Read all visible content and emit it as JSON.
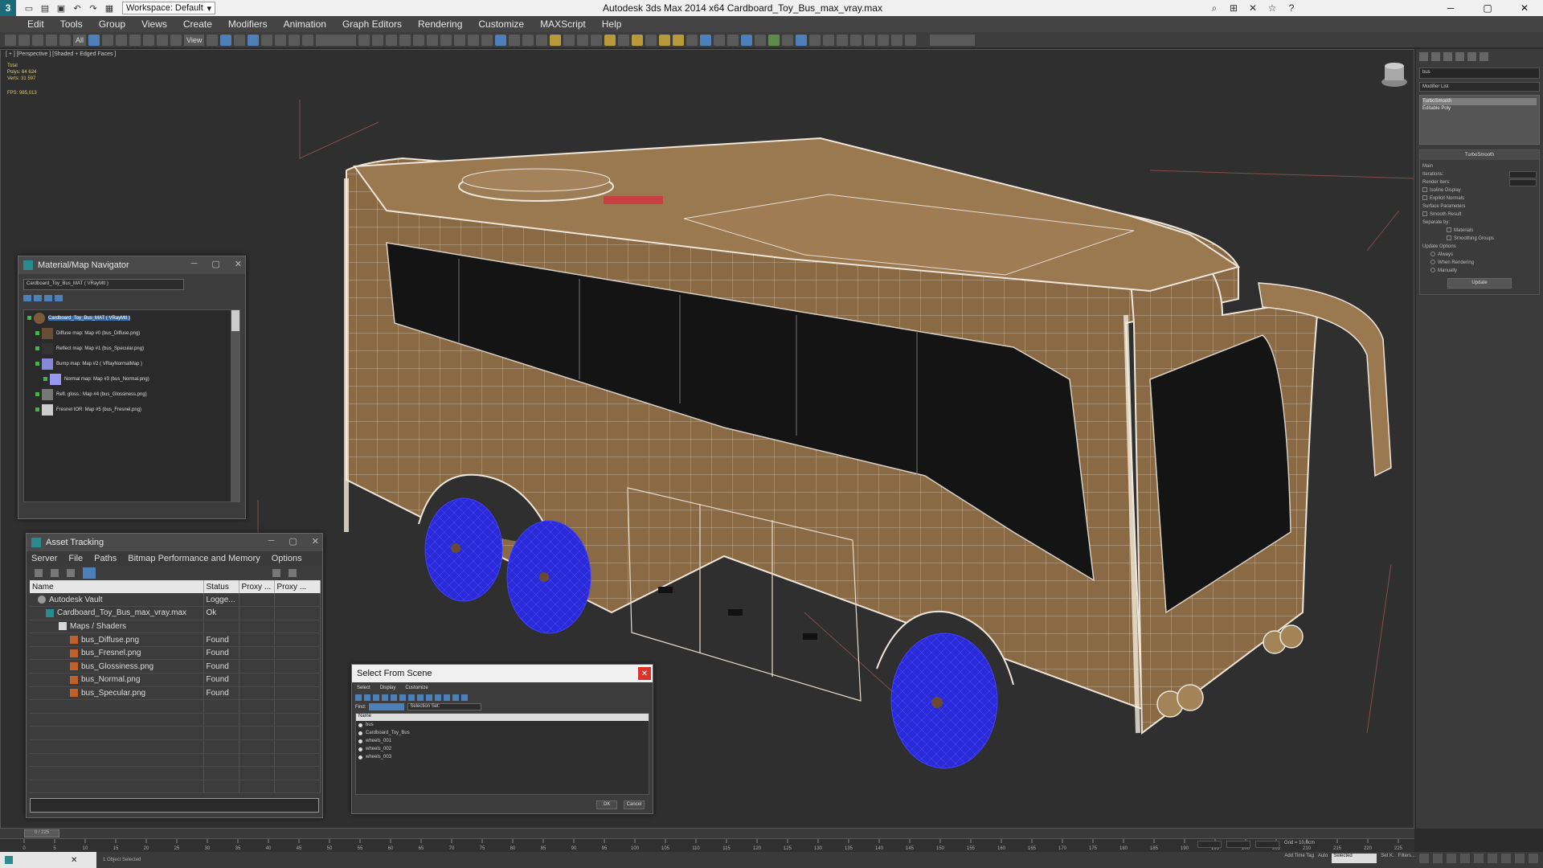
{
  "titlebar": {
    "workspace": "Workspace: Default",
    "title": "Autodesk 3ds Max  2014 x64      Cardboard_Toy_Bus_max_vray.max"
  },
  "menu": [
    "Edit",
    "Tools",
    "Group",
    "Views",
    "Create",
    "Modifiers",
    "Animation",
    "Graph Editors",
    "Rendering",
    "Customize",
    "MAXScript",
    "Help"
  ],
  "toolbar": {
    "selection_filter": "All",
    "view_label": "View"
  },
  "viewport": {
    "label": "[ + ] [Perspective ] [Shaded + Edged Faces ]",
    "stats": {
      "total_label": "Total",
      "polys_label": "Polys:",
      "polys_value": "64 624",
      "verts_label": "Verts:",
      "verts_value": "31 597",
      "fps_label": "FPS:",
      "fps_value": "985,013"
    }
  },
  "command_panel": {
    "object_name": "bus",
    "modifier_list": "Modifier List",
    "stack": [
      "TurboSmooth",
      "Editable Poly"
    ],
    "turbosmooth": {
      "title": "TurboSmooth",
      "main_label": "Main",
      "iterations_label": "Iterations:",
      "render_iters_label": "Render Iters:",
      "isoline_label": "Isoline Display",
      "explicit_label": "Explicit Normals",
      "surface_title": "Surface Parameters",
      "smooth_result": "Smooth Result",
      "separate_label": "Separate by:",
      "materials_label": "Materials",
      "smoothing_groups_label": "Smoothing Groups",
      "update_title": "Update Options",
      "always_label": "Always",
      "when_rendering_label": "When Rendering",
      "manually_label": "Manually",
      "update_button": "Update"
    }
  },
  "material_navigator": {
    "title": "Material/Map Navigator",
    "field": "Cardboard_Toy_Bus_MAT  ( VRayMtl )",
    "items": [
      {
        "label": "Cardboard_Toy_Bus_MAT  ( VRayMtl )",
        "selected": true
      },
      {
        "label": "Diffuse map: Map #0 (bus_Diffuse.png)",
        "selected": false
      },
      {
        "label": "Reflect map: Map #1 (bus_Specular.png)",
        "selected": false
      },
      {
        "label": "Bump map: Map #2  ( VRayNormalMap )",
        "selected": false
      },
      {
        "label": "Normal map: Map #3 (bus_Normal.png)",
        "selected": false
      },
      {
        "label": "Refl. gloss.: Map #4 (bus_Glossiness.png)",
        "selected": false
      },
      {
        "label": "Fresnel IOR: Map #5 (bus_Fresnel.png)",
        "selected": false
      }
    ]
  },
  "asset_tracking": {
    "title": "Asset Tracking",
    "menu": [
      "Server",
      "File",
      "Paths",
      "Bitmap Performance and Memory",
      "Options"
    ],
    "columns": [
      "Name",
      "Status",
      "Proxy ...",
      "Proxy ..."
    ],
    "rows": [
      {
        "name": "Autodesk Vault",
        "status": "Logge...",
        "icon": "vault"
      },
      {
        "name": "Cardboard_Toy_Bus_max_vray.max",
        "status": "Ok",
        "icon": "max"
      },
      {
        "name": "Maps / Shaders",
        "status": "",
        "icon": "folder"
      },
      {
        "name": "bus_Diffuse.png",
        "status": "Found",
        "icon": "png"
      },
      {
        "name": "bus_Fresnel.png",
        "status": "Found",
        "icon": "png"
      },
      {
        "name": "bus_Glossiness.png",
        "status": "Found",
        "icon": "png"
      },
      {
        "name": "bus_Normal.png",
        "status": "Found",
        "icon": "png"
      },
      {
        "name": "bus_Specular.png",
        "status": "Found",
        "icon": "png"
      }
    ]
  },
  "select_from_scene": {
    "title": "Select From Scene",
    "menu": [
      "Select",
      "Display",
      "Customize"
    ],
    "find_label": "Find:",
    "selection_set_label": "Selection Set:",
    "column": "Name",
    "items": [
      "bus",
      "Cardboard_Toy_Bus",
      "wheels_001",
      "wheels_002",
      "wheels_003"
    ],
    "ok": "OK",
    "cancel": "Cancel"
  },
  "timeline": {
    "slider": "0 / 225",
    "ticks": [
      "0",
      "5",
      "10",
      "15",
      "20",
      "25",
      "30",
      "35",
      "40",
      "45",
      "50",
      "55",
      "60",
      "65",
      "70",
      "75",
      "80",
      "85",
      "90",
      "95",
      "100",
      "105",
      "110",
      "115",
      "120",
      "125",
      "130",
      "135",
      "140",
      "145",
      "150",
      "155",
      "160",
      "165",
      "170",
      "175",
      "180",
      "185",
      "190",
      "195",
      "200",
      "205",
      "210",
      "215",
      "220",
      "225"
    ]
  },
  "status": {
    "prompt": "1 Object Selected",
    "grid": "Grid = 10,0cm",
    "add_time_tag": "Add Time Tag",
    "auto_label": "Auto",
    "selected_dropdown": "Selected",
    "set_key": "Set K.",
    "filters": "Filters..."
  },
  "colors": {
    "viewport_bg": "#2f2f2f",
    "cardboard": "#8a6a45",
    "wheel_blue": "#2a2ad8",
    "selection_blue": "#3a6ea8"
  }
}
